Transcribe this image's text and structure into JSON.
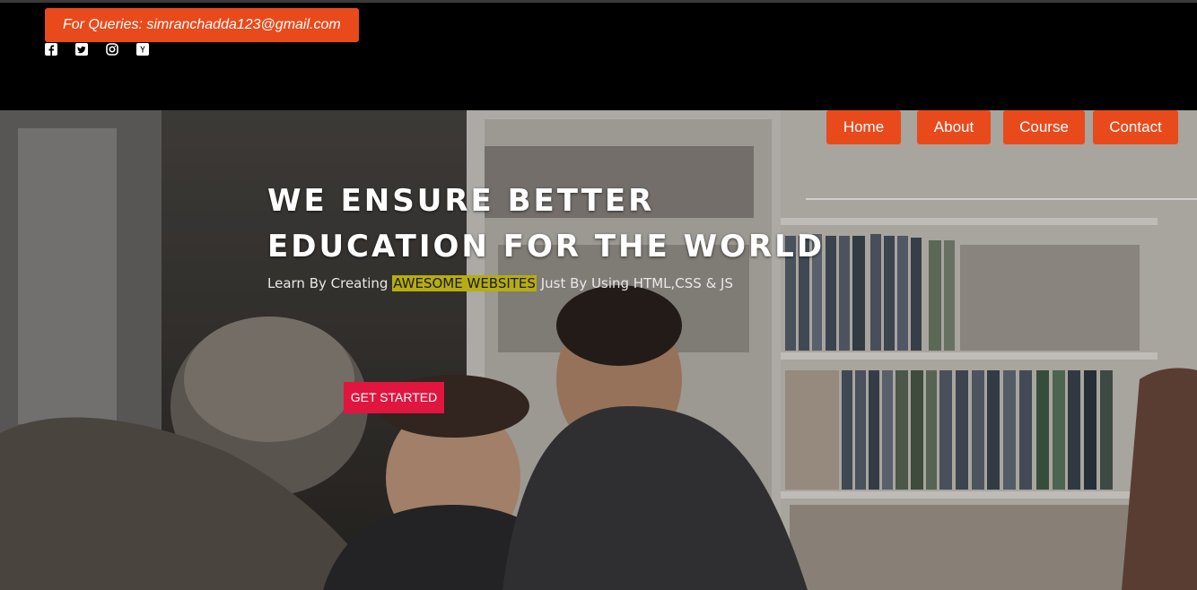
{
  "header": {
    "queries_text": "For Queries: simranchadda123@gmail.com",
    "socials": [
      {
        "name": "facebook-icon"
      },
      {
        "name": "twitter-icon"
      },
      {
        "name": "instagram-icon"
      },
      {
        "name": "ycombinator-icon"
      }
    ]
  },
  "nav": {
    "items": [
      {
        "label": "Home"
      },
      {
        "label": "About"
      },
      {
        "label": "Course"
      },
      {
        "label": "Contact"
      }
    ]
  },
  "hero": {
    "headline_line1": "WE ENSURE BETTER",
    "headline_line2": "EDUCATION FOR THE WORLD",
    "sub_before": "Learn By Creating ",
    "sub_highlight": "AWESOME WEBSITES",
    "sub_after": " Just By Using HTML,CSS & JS",
    "cta_label": "GET STARTED"
  },
  "colors": {
    "accent": "#e84a1c",
    "cta": "#e0163f",
    "highlight": "#b5ad12"
  }
}
